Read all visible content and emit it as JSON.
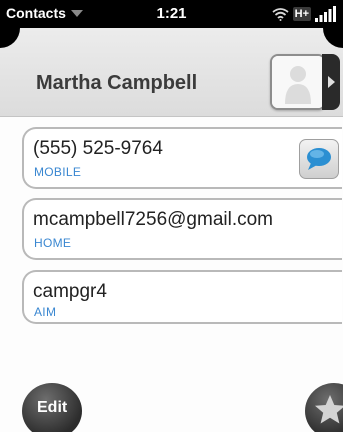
{
  "status_bar": {
    "app_menu_label": "Contacts",
    "time": "1:21",
    "network": "H+",
    "icons": [
      "wifi-icon",
      "signal-icon"
    ]
  },
  "header": {
    "contact_name": "Martha Campbell",
    "photo_icon": "person-silhouette-icon"
  },
  "entries": [
    {
      "value": "(555) 525-9764",
      "label": "MOBILE",
      "action_icon": "speech-bubble-icon"
    },
    {
      "value": "mcampbell7256@gmail.com",
      "label": "HOME"
    },
    {
      "value": "campgr4",
      "label": "AIM"
    }
  ],
  "bottom_bar": {
    "edit_label": "Edit",
    "favorite_icon": "star-icon"
  },
  "colors": {
    "label_blue": "#3a87d1",
    "sms_bubble": "#2b8fd2"
  }
}
